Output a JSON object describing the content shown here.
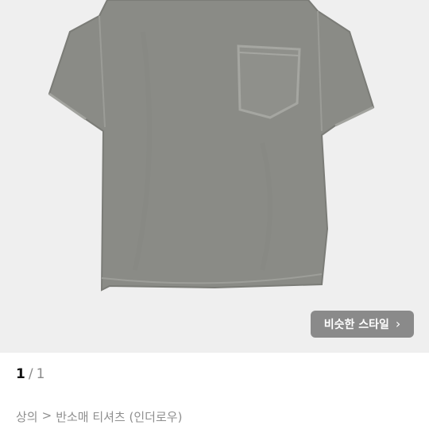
{
  "product_image": {
    "alt_subject": "tshirt-photo",
    "bg_color": "#efefef",
    "shirt_color": "#8a8b86"
  },
  "similar_style_button": {
    "label": "비슷한 스타일",
    "icon": "chevron-right-icon"
  },
  "pager": {
    "current": "1",
    "separator": "/",
    "total": "1"
  },
  "breadcrumb": {
    "category": "상의",
    "separator": ">",
    "subcategory": "반소매 티셔츠 (인더로우)"
  }
}
